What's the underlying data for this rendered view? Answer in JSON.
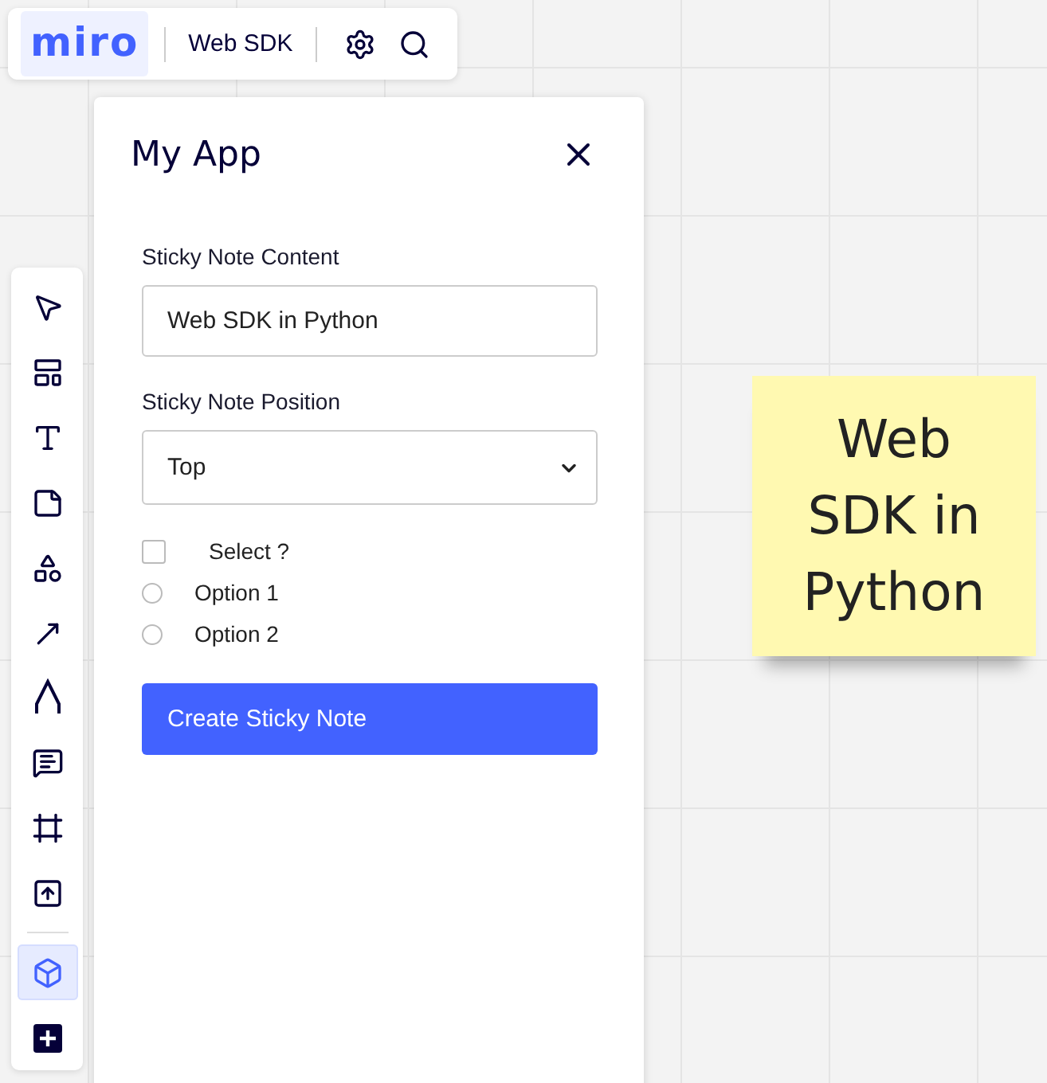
{
  "header": {
    "logo": "miro",
    "board_name": "Web SDK"
  },
  "toolbar": {
    "tools": [
      {
        "kind": "select",
        "selected": false
      },
      {
        "kind": "templates",
        "selected": false
      },
      {
        "kind": "text",
        "selected": false
      },
      {
        "kind": "sticky",
        "selected": false
      },
      {
        "kind": "shapes",
        "selected": false
      },
      {
        "kind": "arrow",
        "selected": false
      },
      {
        "kind": "pen",
        "selected": false
      },
      {
        "kind": "comment",
        "selected": false
      },
      {
        "kind": "frame",
        "selected": false
      },
      {
        "kind": "upload",
        "selected": false
      },
      {
        "kind": "divider"
      },
      {
        "kind": "apps",
        "selected": true
      },
      {
        "kind": "more",
        "selected": false
      }
    ]
  },
  "panel": {
    "title": "My App",
    "fields": [
      {
        "kind": "text",
        "label": "Sticky Note Content",
        "value": "Web SDK in Python"
      },
      {
        "kind": "select",
        "label": "Sticky Note Position",
        "value": "Top"
      }
    ],
    "checkbox": {
      "label": "Select ?",
      "checked": false
    },
    "radios": [
      {
        "label": "Option 1",
        "selected": false
      },
      {
        "label": "Option 2",
        "selected": false
      }
    ],
    "button": "Create Sticky Note"
  },
  "sticky_note": {
    "text": "Web SDK in Python"
  }
}
